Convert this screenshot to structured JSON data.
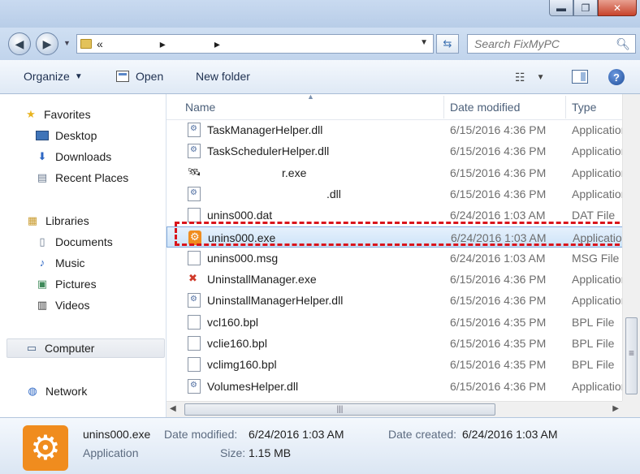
{
  "window": {
    "min_glyph": "▬",
    "max_glyph": "❐",
    "close_glyph": "✕"
  },
  "address": {
    "path_prefix": "«",
    "separator": "▸",
    "search_placeholder": "Search FixMyPC"
  },
  "toolbar": {
    "organize": "Organize",
    "open": "Open",
    "new_folder": "New folder"
  },
  "nav": {
    "favorites": "Favorites",
    "desktop": "Desktop",
    "downloads": "Downloads",
    "recent_places": "Recent Places",
    "libraries": "Libraries",
    "documents": "Documents",
    "music": "Music",
    "pictures": "Pictures",
    "videos": "Videos",
    "computer": "Computer",
    "network": "Network"
  },
  "columns": {
    "name": "Name",
    "date_modified": "Date modified",
    "type": "Type"
  },
  "files": [
    {
      "name": "TaskManagerHelper.dll",
      "date": "6/15/2016 4:36 PM",
      "type": "Application extension",
      "icon": "dll-icon"
    },
    {
      "name": "TaskSchedulerHelper.dll",
      "date": "6/15/2016 4:36 PM",
      "type": "Application extension",
      "icon": "dll-icon"
    },
    {
      "name": "r.exe",
      "date": "6/15/2016 4:36 PM",
      "type": "Application",
      "icon": "satellite-icon",
      "redacted": true
    },
    {
      "name": ".dll",
      "date": "6/15/2016 4:36 PM",
      "type": "Application extension",
      "icon": "dll-icon",
      "redacted": true
    },
    {
      "name": "unins000.dat",
      "date": "6/24/2016 1:03 AM",
      "type": "DAT File",
      "icon": "document-icon"
    },
    {
      "name": "unins000.exe",
      "date": "6/24/2016 1:03 AM",
      "type": "Application",
      "icon": "gear-icon",
      "selected": true
    },
    {
      "name": "unins000.msg",
      "date": "6/24/2016 1:03 AM",
      "type": "MSG File",
      "icon": "document-icon"
    },
    {
      "name": "UninstallManager.exe",
      "date": "6/15/2016 4:36 PM",
      "type": "Application",
      "icon": "uninstall-icon"
    },
    {
      "name": "UninstallManagerHelper.dll",
      "date": "6/15/2016 4:36 PM",
      "type": "Application extension",
      "icon": "dll-icon"
    },
    {
      "name": "vcl160.bpl",
      "date": "6/15/2016 4:35 PM",
      "type": "BPL File",
      "icon": "document-icon"
    },
    {
      "name": "vclie160.bpl",
      "date": "6/15/2016 4:35 PM",
      "type": "BPL File",
      "icon": "document-icon"
    },
    {
      "name": "vclimg160.bpl",
      "date": "6/15/2016 4:35 PM",
      "type": "BPL File",
      "icon": "document-icon"
    },
    {
      "name": "VolumesHelper.dll",
      "date": "6/15/2016 4:36 PM",
      "type": "Application extension",
      "icon": "dll-icon"
    }
  ],
  "details": {
    "filename": "unins000.exe",
    "kind": "Application",
    "modified_label": "Date modified:",
    "modified_value": "6/24/2016 1:03 AM",
    "created_label": "Date created:",
    "created_value": "6/24/2016 1:03 AM",
    "size_label": "Size:",
    "size_value": "1.15 MB"
  },
  "colors": {
    "highlight_border": "#d9141b",
    "app_icon": "#f08c1e"
  }
}
